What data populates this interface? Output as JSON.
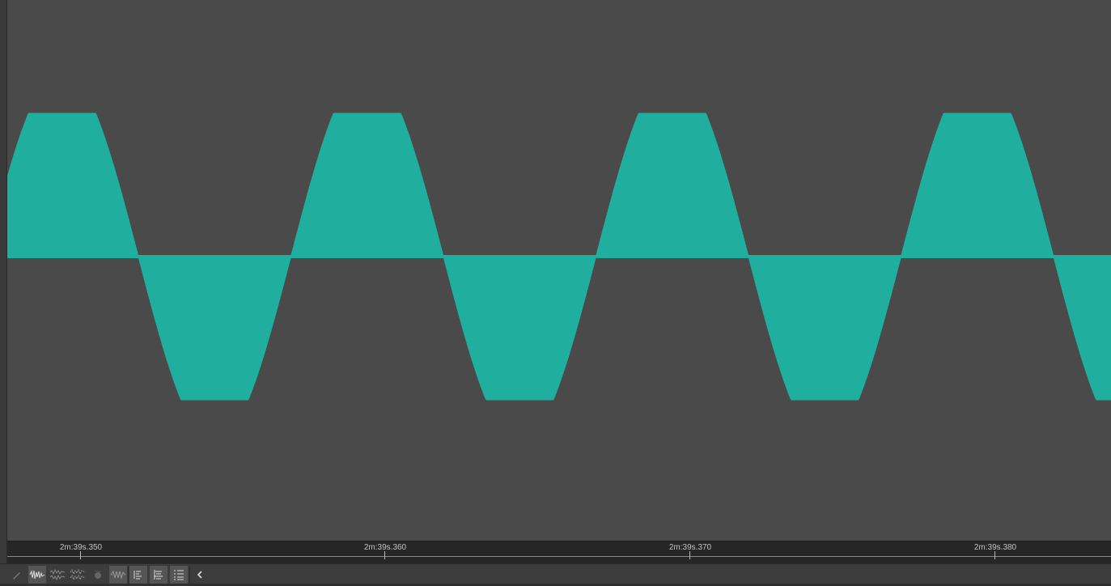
{
  "colors": {
    "background": "#4a4a4a",
    "waveform": "#20ae9e",
    "ruler_bg": "#262626",
    "toolbar_bg": "#3c3c3c"
  },
  "timeline": {
    "ticks": [
      {
        "label": "2m:39s.350"
      },
      {
        "label": "2m:39s.360"
      },
      {
        "label": "2m:39s.370"
      },
      {
        "label": "2m:39s.380"
      }
    ]
  },
  "toolbar": {
    "buttons": [
      {
        "name": "pencil-tool-button",
        "icon": "pencil-icon"
      },
      {
        "name": "waveform-view-button",
        "icon": "waveform-icon"
      },
      {
        "name": "waveform-split-view-button",
        "icon": "waveform-split-icon"
      },
      {
        "name": "waveform-stereo-view-button",
        "icon": "waveform-stereo-icon"
      },
      {
        "name": "marker-button",
        "icon": "marker-icon"
      },
      {
        "name": "waveform-overview-button",
        "icon": "waveform-overview-icon"
      },
      {
        "name": "align-left-button",
        "icon": "align-left-icon"
      },
      {
        "name": "align-center-button",
        "icon": "align-center-icon"
      },
      {
        "name": "list-view-button",
        "icon": "list-icon"
      },
      {
        "name": "collapse-toolbar-button",
        "icon": "chevron-left-icon"
      }
    ]
  }
}
